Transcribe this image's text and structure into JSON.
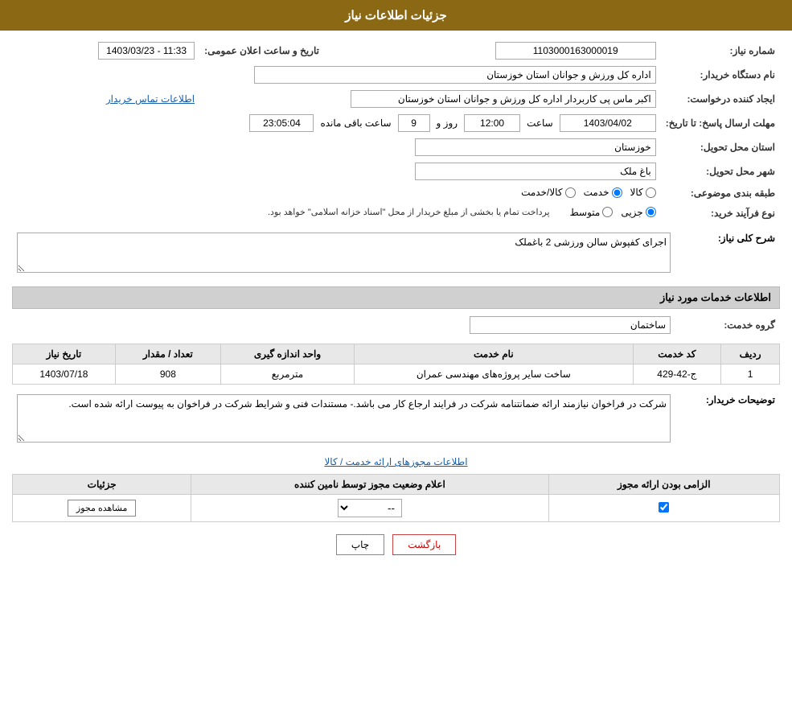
{
  "header": {
    "title": "جزئیات اطلاعات نیاز"
  },
  "fields": {
    "notice_number_label": "شماره نیاز:",
    "notice_number_value": "1103000163000019",
    "buyer_org_label": "نام دستگاه خریدار:",
    "buyer_org_value": "اداره کل ورزش و جوانان استان خوزستان",
    "request_creator_label": "ایجاد کننده درخواست:",
    "request_creator_value": "اکبر ماس پی کاربردار اداره کل ورزش و جوانان استان خوزستان",
    "contact_info_link": "اطلاعات تماس خریدار",
    "send_deadline_label": "مهلت ارسال پاسخ: تا تاریخ:",
    "send_date_value": "1403/04/02",
    "send_time_label": "ساعت",
    "send_time_value": "12:00",
    "send_days_label": "روز و",
    "send_days_value": "9",
    "send_remaining_label": "ساعت باقی مانده",
    "send_remaining_value": "23:05:04",
    "delivery_province_label": "استان محل تحویل:",
    "delivery_province_value": "خوزستان",
    "delivery_city_label": "شهر محل تحویل:",
    "delivery_city_value": "باغ ملک",
    "category_label": "طبقه بندی موضوعی:",
    "category_options": [
      {
        "label": "کالا",
        "value": "kala"
      },
      {
        "label": "خدمت",
        "value": "khedmat"
      },
      {
        "label": "کالا/خدمت",
        "value": "kala_khedmat"
      }
    ],
    "category_selected": "khedmat",
    "purchase_type_label": "نوع فرآیند خرید:",
    "purchase_type_options": [
      {
        "label": "جزیی",
        "value": "jozi"
      },
      {
        "label": "متوسط",
        "value": "motavaset"
      }
    ],
    "purchase_type_selected": "jozi",
    "purchase_type_note": "پرداخت تمام یا بخشی از مبلغ خریدار از محل \"اسناد خزانه اسلامی\" خواهد بود.",
    "announce_datetime_label": "تاریخ و ساعت اعلان عمومی:",
    "announce_datetime_value": "1403/03/23 - 11:33"
  },
  "need_summary": {
    "section_title": "شرح کلی نیاز:",
    "value": "اجرای کفپوش سالن ورزشی 2 باغملک"
  },
  "services_section": {
    "title": "اطلاعات خدمات مورد نیاز",
    "service_group_label": "گروه خدمت:",
    "service_group_value": "ساختمان",
    "table_headers": [
      "ردیف",
      "کد خدمت",
      "نام خدمت",
      "واحد اندازه گیری",
      "تعداد / مقدار",
      "تاریخ نیاز"
    ],
    "table_rows": [
      {
        "row": "1",
        "code": "ج-42-429",
        "name": "ساخت سایر پروژه‌های مهندسی عمران",
        "unit": "مترمربع",
        "quantity": "908",
        "date": "1403/07/18"
      }
    ]
  },
  "buyer_notes": {
    "label": "توضیحات خریدار:",
    "value": "شرکت در فراخوان نیازمند ارائه ضمانتنامه شرکت در فرایند ارجاع کار می باشد.- مستندات فنی و شرایط شرکت در فراخوان به پیوست ارائه شده است."
  },
  "permits_section": {
    "title": "اطلاعات مجوزهای ارائه خدمت / کالا",
    "table_headers": [
      "الزامی بودن ارائه مجوز",
      "اعلام وضعیت مجوز توسط نامین کننده",
      "جزئیات"
    ],
    "table_rows": [
      {
        "required": true,
        "status": "--",
        "detail_btn": "مشاهده مجوز"
      }
    ]
  },
  "buttons": {
    "print": "چاپ",
    "back": "بازگشت"
  }
}
